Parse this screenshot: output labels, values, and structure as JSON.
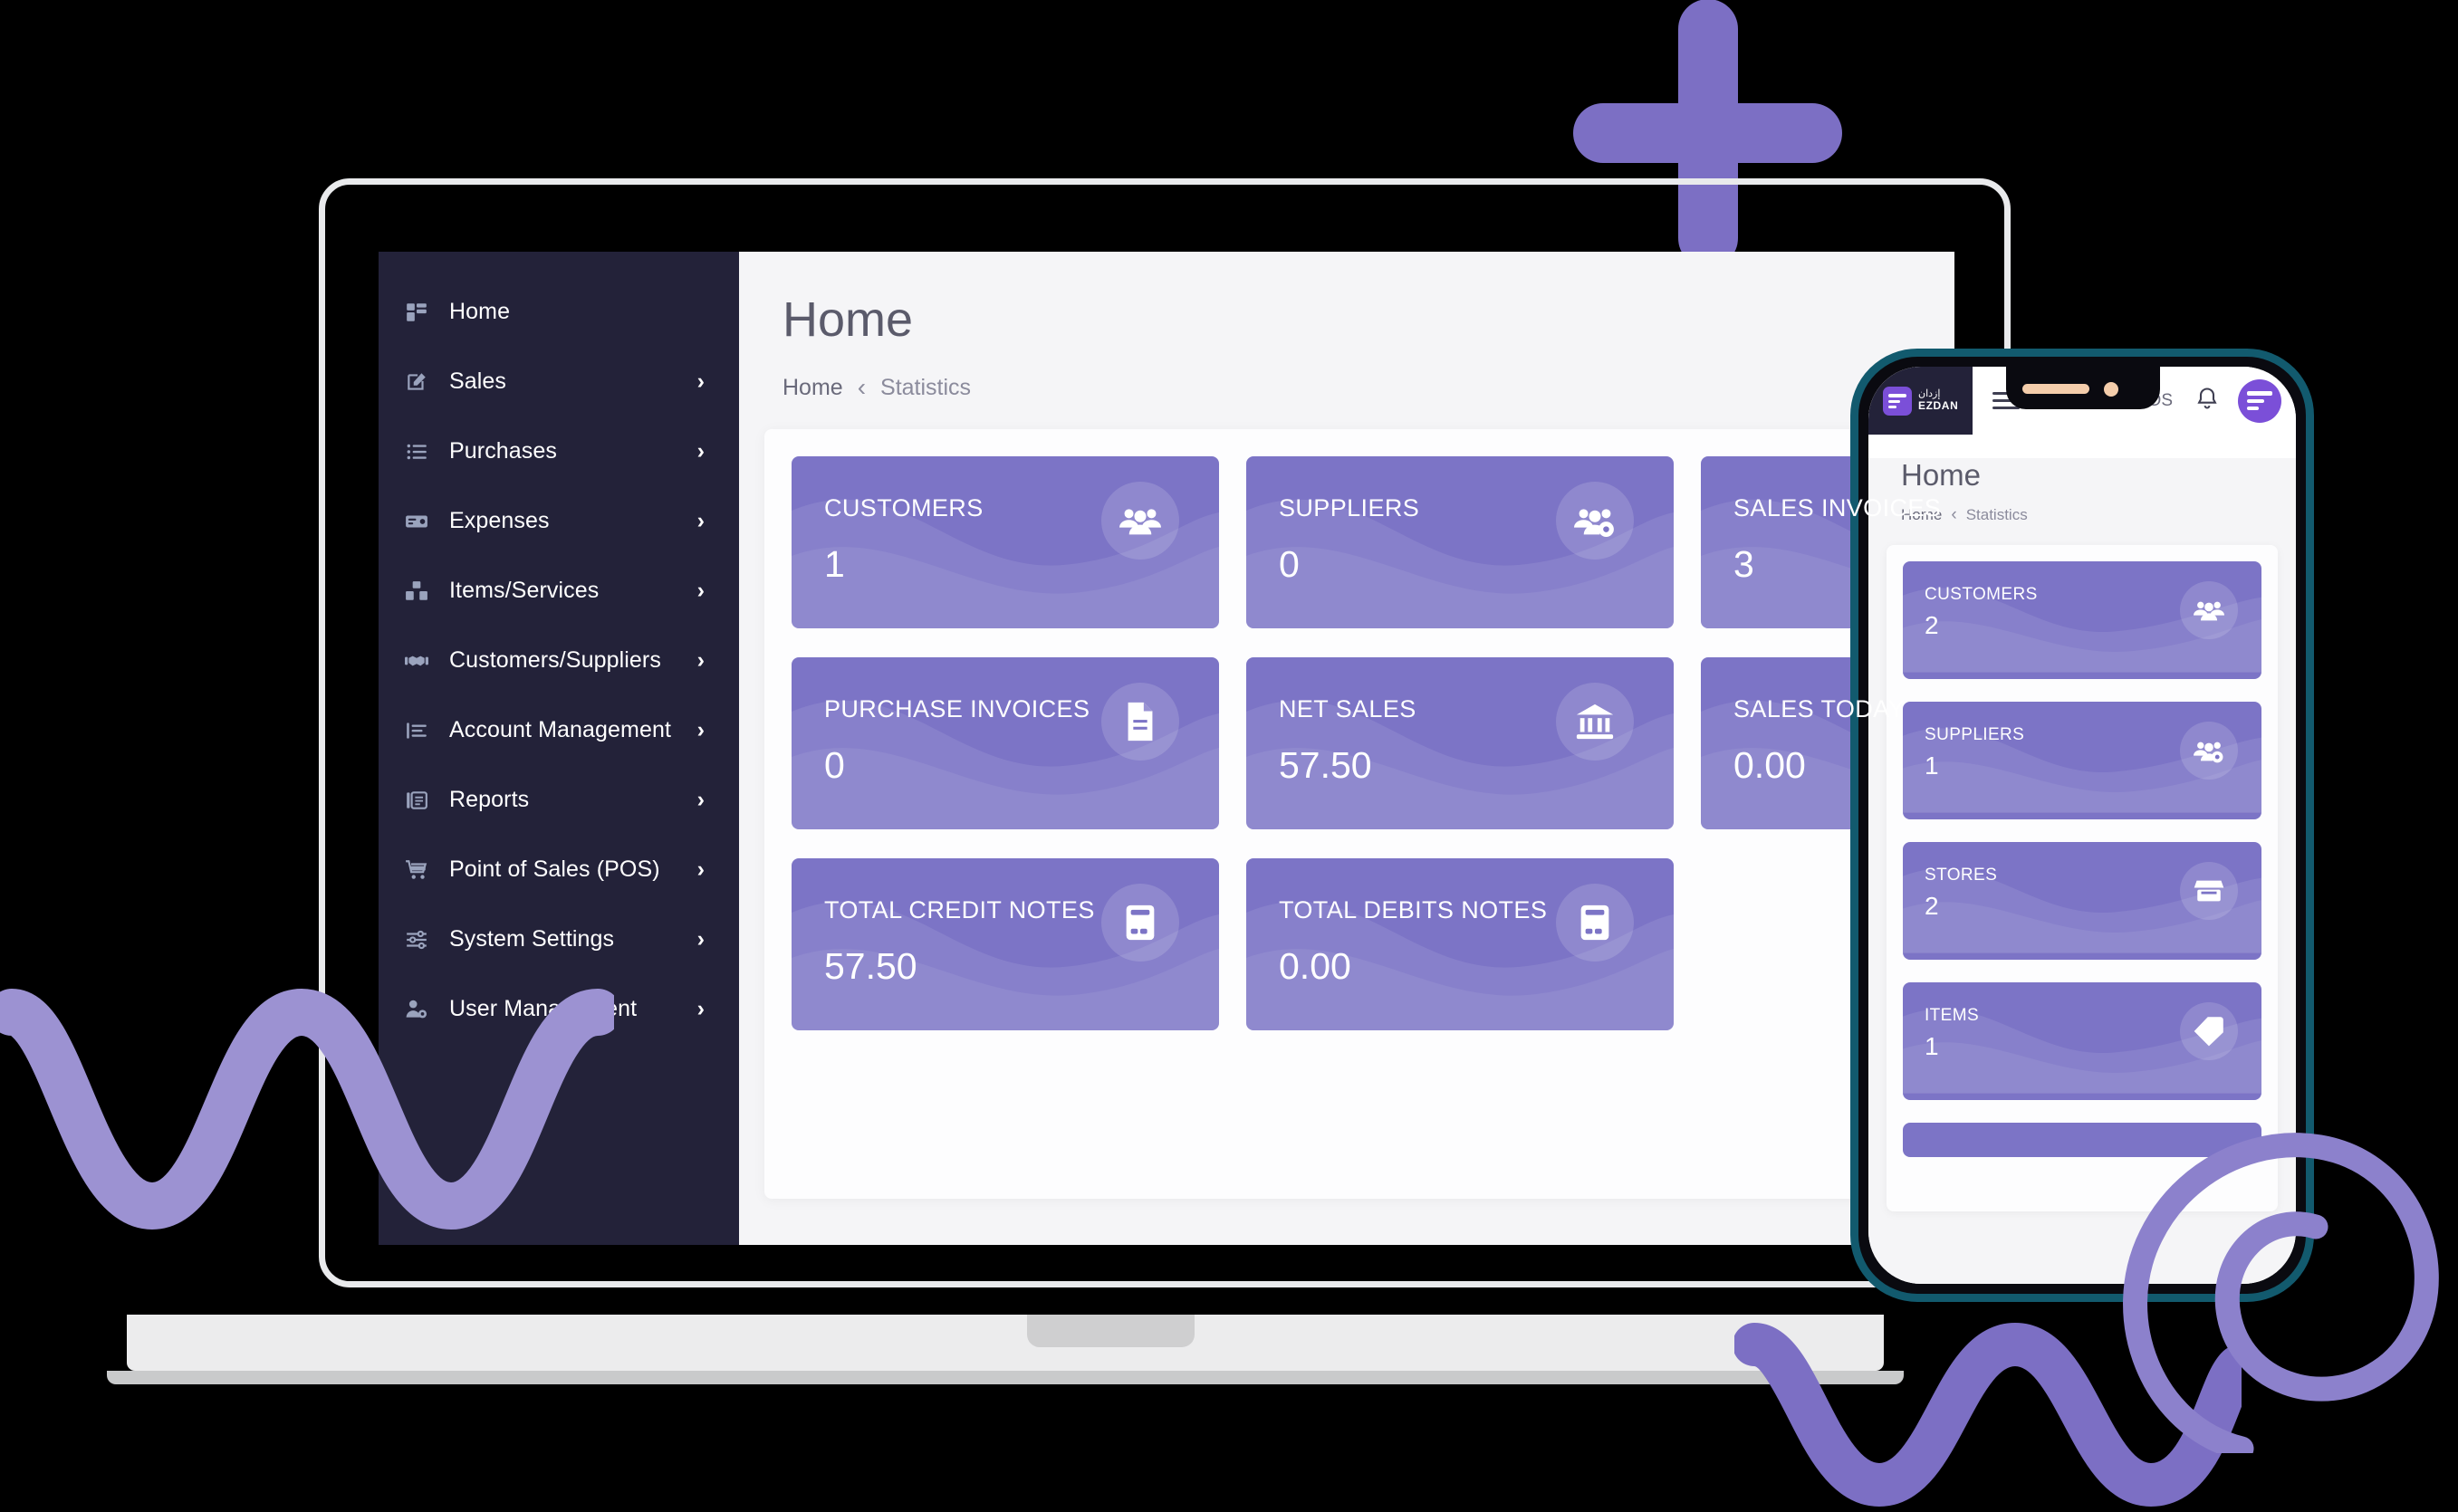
{
  "brand": {
    "name_en": "EZDAN",
    "name_ar": "إزدان",
    "accent": "#7b4fd8",
    "card_purple": "#7c74c6",
    "sidebar_bg": "#232239",
    "phone_frame": "#125a6e"
  },
  "desktop": {
    "sidebar": {
      "items": [
        {
          "label": "Home",
          "icon": "dashboard-icon",
          "chevron": ""
        },
        {
          "label": "Sales",
          "icon": "edit-icon",
          "chevron": "›"
        },
        {
          "label": "Purchases",
          "icon": "list-icon",
          "chevron": "›"
        },
        {
          "label": "Expenses",
          "icon": "card-icon",
          "chevron": "›"
        },
        {
          "label": "Items/Services",
          "icon": "boxes-icon",
          "chevron": "›"
        },
        {
          "label": "Customers/Suppliers",
          "icon": "handshake-icon",
          "chevron": "›"
        },
        {
          "label": "Account Management",
          "icon": "ledger-icon",
          "chevron": "›"
        },
        {
          "label": "Reports",
          "icon": "report-icon",
          "chevron": "›"
        },
        {
          "label": "Point of Sales (POS)",
          "icon": "cart-icon",
          "chevron": "›"
        },
        {
          "label": "System Settings",
          "icon": "sliders-icon",
          "chevron": "›"
        },
        {
          "label": "User Management",
          "icon": "user-gear-icon",
          "chevron": "›"
        }
      ]
    },
    "page_title": "Home",
    "breadcrumb": {
      "root": "Home",
      "separator": "‹",
      "current": "Statistics"
    },
    "cards": [
      {
        "label": "CUSTOMERS",
        "value": "1",
        "icon": "people-icon"
      },
      {
        "label": "SUPPLIERS",
        "value": "0",
        "icon": "people-gear-icon"
      },
      {
        "label": "SALES INVOICES",
        "value": "3",
        "icon": "invoice-dollar-icon"
      },
      {
        "label": "PURCHASE INVOICES",
        "value": "0",
        "icon": "invoice-icon"
      },
      {
        "label": "NET SALES",
        "value": "57.50",
        "icon": "bank-icon"
      },
      {
        "label": "SALES TODAY",
        "value": "0.00",
        "icon": "bank-icon"
      },
      {
        "label": "TOTAL CREDIT NOTES",
        "value": "57.50",
        "icon": "credit-card-icon"
      },
      {
        "label": "TOTAL DEBITS NOTES",
        "value": "0.00",
        "icon": "credit-card-icon"
      }
    ]
  },
  "phone": {
    "topbar": {
      "menu_icon": "hamburger-icon",
      "pos_label": "POS",
      "bell_icon": "bell-icon",
      "avatar_icon": "ezdan-avatar-icon"
    },
    "page_title": "Home",
    "breadcrumb": {
      "root": "Home",
      "separator": "‹",
      "current": "Statistics"
    },
    "cards": [
      {
        "label": "CUSTOMERS",
        "value": "2",
        "icon": "people-icon"
      },
      {
        "label": "SUPPLIERS",
        "value": "1",
        "icon": "people-gear-icon"
      },
      {
        "label": "STORES",
        "value": "2",
        "icon": "store-icon"
      },
      {
        "label": "ITEMS",
        "value": "1",
        "icon": "tag-icon"
      }
    ]
  },
  "decorations": {
    "plus": "plus-shape",
    "squiggle_left": "wave-squiggle-left",
    "squiggle_right": "wave-squiggle-right",
    "spiral": "spiral-shape"
  }
}
